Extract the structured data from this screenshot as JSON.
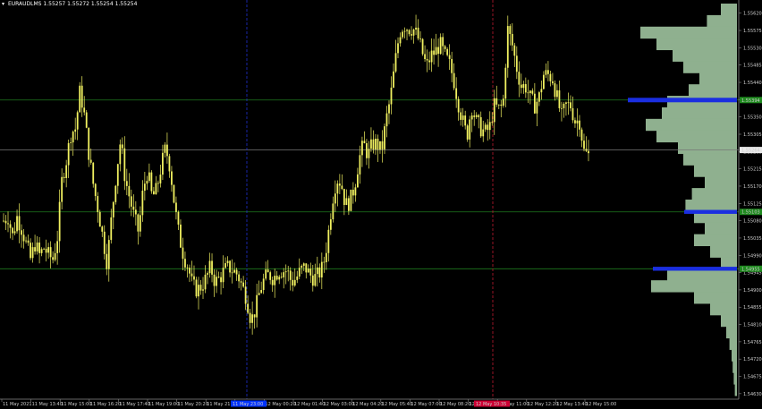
{
  "header": {
    "arrow_icon": "down-triangle-icon",
    "symbol": "EURAUDLMS",
    "prices": "1.55257 1.55272 1.55254 1.55254"
  },
  "price_axis": {
    "labels": [
      "1.55620",
      "1.55575",
      "1.55530",
      "1.55485",
      "1.55440",
      "1.55395",
      "1.55350",
      "1.55305",
      "1.55260",
      "1.55215",
      "1.55170",
      "1.55125",
      "1.55080",
      "1.55035",
      "1.54990",
      "1.54945",
      "1.54900",
      "1.54855",
      "1.54810",
      "1.54765",
      "1.54720",
      "1.54675",
      "1.54630"
    ],
    "levels": [
      {
        "value": "1.55394",
        "role": "upper-poc"
      },
      {
        "value": "1.55264",
        "role": "current-price"
      },
      {
        "value": "1.55103",
        "role": "mid-level"
      },
      {
        "value": "1.54955",
        "role": "lower-level"
      }
    ]
  },
  "time_axis": {
    "labels": [
      "11 May 2021",
      "11 May 13:40",
      "11 May 15:00",
      "11 May 16:20",
      "11 May 17:40",
      "11 May 19:00",
      "11 May 20:20",
      "11 May 21:40",
      "11 May 23:00",
      "12 May 00:20",
      "12 May 01:40",
      "12 May 03:00",
      "12 May 04:20",
      "12 May 05:40",
      "12 May 07:00",
      "12 May 08:20",
      "12 May 09:40",
      "12 May 11:00",
      "12 May 12:20",
      "12 May 13:40",
      "12 May 15:00"
    ],
    "markers": [
      {
        "text": "11 May 23:00",
        "color": "#0033ff"
      },
      {
        "text": "12 May 10:35",
        "color": "#cc0033"
      }
    ]
  },
  "colors": {
    "background": "#000000",
    "candles": "#f0f060",
    "profile": "#8fb08f",
    "poc": "#1a2ee0",
    "level_line": "#1f7a1f",
    "price_line": "#777777",
    "blue_vline": "#2030d0",
    "red_vline": "#c01a30"
  },
  "chart_data": {
    "type": "candlestick",
    "symbol": "EURAUDLMS",
    "ylim": [
      1.5462,
      1.5566
    ],
    "timeframe_span": [
      "11 May 2021",
      "12 May 15:00"
    ],
    "close_path": [
      [
        0,
        1.5508
      ],
      [
        1,
        1.5509
      ],
      [
        2,
        1.5504
      ],
      [
        3,
        1.5509
      ],
      [
        4,
        1.5506
      ],
      [
        5,
        1.5502
      ],
      [
        6,
        1.5498
      ],
      [
        7,
        1.5502
      ],
      [
        8,
        1.5499
      ],
      [
        9,
        1.5501
      ],
      [
        10,
        1.5499
      ],
      [
        11,
        1.5498
      ],
      [
        12,
        1.5504
      ],
      [
        13,
        1.5519
      ],
      [
        14,
        1.5524
      ],
      [
        15,
        1.5531
      ],
      [
        16,
        1.5532
      ],
      [
        17,
        1.5542
      ],
      [
        18,
        1.5535
      ],
      [
        19,
        1.5525
      ],
      [
        20,
        1.5517
      ],
      [
        21,
        1.5511
      ],
      [
        22,
        1.5504
      ],
      [
        23,
        1.5497
      ],
      [
        24,
        1.5509
      ],
      [
        25,
        1.552
      ],
      [
        26,
        1.5529
      ],
      [
        27,
        1.5519
      ],
      [
        28,
        1.5514
      ],
      [
        29,
        1.5509
      ],
      [
        30,
        1.5505
      ],
      [
        31,
        1.5516
      ],
      [
        32,
        1.5521
      ],
      [
        33,
        1.5514
      ],
      [
        34,
        1.5516
      ],
      [
        35,
        1.5522
      ],
      [
        36,
        1.5527
      ],
      [
        37,
        1.5522
      ],
      [
        38,
        1.5512
      ],
      [
        39,
        1.5504
      ],
      [
        40,
        1.5499
      ],
      [
        41,
        1.5496
      ],
      [
        42,
        1.5491
      ],
      [
        43,
        1.549
      ],
      [
        44,
        1.5491
      ],
      [
        45,
        1.5493
      ],
      [
        46,
        1.5496
      ],
      [
        47,
        1.5492
      ],
      [
        48,
        1.5493
      ],
      [
        49,
        1.5495
      ],
      [
        50,
        1.5496
      ],
      [
        51,
        1.5495
      ],
      [
        52,
        1.5494
      ],
      [
        53,
        1.5491
      ],
      [
        54,
        1.5488
      ],
      [
        55,
        1.5482
      ],
      [
        56,
        1.5485
      ],
      [
        57,
        1.549
      ],
      [
        58,
        1.5493
      ],
      [
        59,
        1.5494
      ],
      [
        60,
        1.5493
      ],
      [
        61,
        1.5495
      ],
      [
        62,
        1.5495
      ],
      [
        63,
        1.5495
      ],
      [
        64,
        1.5492
      ],
      [
        65,
        1.5493
      ],
      [
        66,
        1.5495
      ],
      [
        67,
        1.5496
      ],
      [
        68,
        1.5494
      ],
      [
        69,
        1.5493
      ],
      [
        70,
        1.5494
      ],
      [
        71,
        1.5496
      ],
      [
        72,
        1.5503
      ],
      [
        73,
        1.5513
      ],
      [
        74,
        1.5519
      ],
      [
        75,
        1.5518
      ],
      [
        76,
        1.5512
      ],
      [
        77,
        1.5513
      ],
      [
        78,
        1.5517
      ],
      [
        79,
        1.5524
      ],
      [
        80,
        1.5528
      ],
      [
        81,
        1.5525
      ],
      [
        82,
        1.5528
      ],
      [
        83,
        1.5528
      ],
      [
        84,
        1.5526
      ],
      [
        85,
        1.5534
      ],
      [
        86,
        1.554
      ],
      [
        87,
        1.5549
      ],
      [
        88,
        1.5557
      ],
      [
        89,
        1.5559
      ],
      [
        90,
        1.5558
      ],
      [
        91,
        1.5558
      ],
      [
        92,
        1.5556
      ],
      [
        93,
        1.5552
      ],
      [
        94,
        1.5548
      ],
      [
        95,
        1.5551
      ],
      [
        96,
        1.5552
      ],
      [
        97,
        1.5554
      ],
      [
        98,
        1.5551
      ],
      [
        99,
        1.5549
      ],
      [
        100,
        1.5545
      ],
      [
        101,
        1.5539
      ],
      [
        102,
        1.5534
      ],
      [
        103,
        1.553
      ],
      [
        104,
        1.5538
      ],
      [
        105,
        1.5534
      ],
      [
        106,
        1.5532
      ],
      [
        107,
        1.5531
      ],
      [
        108,
        1.5532
      ],
      [
        109,
        1.5538
      ],
      [
        110,
        1.5537
      ],
      [
        111,
        1.5538
      ],
      [
        112,
        1.5558
      ],
      [
        113,
        1.5554
      ],
      [
        114,
        1.5548
      ],
      [
        115,
        1.5543
      ],
      [
        116,
        1.5543
      ],
      [
        117,
        1.554
      ],
      [
        118,
        1.5538
      ],
      [
        119,
        1.554
      ],
      [
        120,
        1.5546
      ],
      [
        121,
        1.5546
      ],
      [
        122,
        1.5545
      ],
      [
        123,
        1.554
      ],
      [
        124,
        1.5535
      ],
      [
        125,
        1.5538
      ],
      [
        126,
        1.5538
      ],
      [
        127,
        1.5534
      ],
      [
        128,
        1.5534
      ],
      [
        129,
        1.5526
      ],
      [
        130,
        1.5525
      ]
    ],
    "volume_profile": [
      [
        1.5563,
        0.15
      ],
      [
        1.556,
        0.28
      ],
      [
        1.5557,
        0.9
      ],
      [
        1.5554,
        0.75
      ],
      [
        1.5551,
        0.6
      ],
      [
        1.5548,
        0.5
      ],
      [
        1.5545,
        0.35
      ],
      [
        1.5542,
        0.45
      ],
      [
        1.5539,
        0.65
      ],
      [
        1.5536,
        0.7
      ],
      [
        1.5533,
        0.85
      ],
      [
        1.553,
        0.75
      ],
      [
        1.5527,
        0.55
      ],
      [
        1.5524,
        0.5
      ],
      [
        1.5521,
        0.4
      ],
      [
        1.5518,
        0.3
      ],
      [
        1.5515,
        0.42
      ],
      [
        1.5512,
        0.48
      ],
      [
        1.5509,
        0.4
      ],
      [
        1.5506,
        0.3
      ],
      [
        1.5503,
        0.4
      ],
      [
        1.55,
        0.25
      ],
      [
        1.5497,
        0.15
      ],
      [
        1.5494,
        0.65
      ],
      [
        1.5491,
        0.8
      ],
      [
        1.5488,
        0.4
      ],
      [
        1.5485,
        0.25
      ],
      [
        1.5482,
        0.15
      ],
      [
        1.5479,
        0.1
      ],
      [
        1.5476,
        0.07
      ],
      [
        1.5473,
        0.05
      ],
      [
        1.547,
        0.04
      ],
      [
        1.5467,
        0.03
      ],
      [
        1.5464,
        0.02
      ]
    ],
    "poc_levels": [
      1.55394,
      1.55103,
      1.54955
    ],
    "current_price": 1.55264
  }
}
